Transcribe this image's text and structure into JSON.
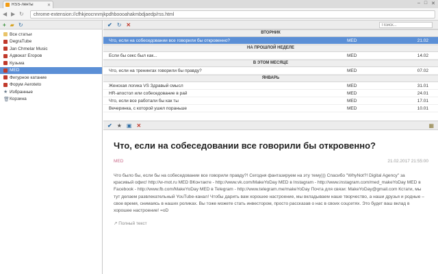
{
  "browser": {
    "tab_title": "RSS-ленты",
    "url": "chrome-extension://cfhkjeocnnmjkpdhboooahakmbdjaedp/rss.html"
  },
  "sidebar": {
    "items": [
      {
        "label": "Все статьи",
        "icon": "folder-icon"
      },
      {
        "label": "DegraTube",
        "icon": "feed-icon"
      },
      {
        "label": "Jan Chmelar Music",
        "icon": "feed-icon"
      },
      {
        "label": "Адвокат Егоров",
        "icon": "feed-icon"
      },
      {
        "label": "Кузьма",
        "icon": "feed-icon"
      },
      {
        "label": "MED",
        "icon": "feed-icon"
      },
      {
        "label": "Фигурное катание",
        "icon": "feed-icon"
      },
      {
        "label": "Форум Aeroteto",
        "icon": "feed-icon"
      },
      {
        "label": "Избранные",
        "icon": "star-icon"
      },
      {
        "label": "Корзина",
        "icon": "trash-icon"
      }
    ]
  },
  "list": {
    "search_placeholder": "Поиск...",
    "groups": [
      {
        "label": "ВТОРНИК",
        "rows": [
          {
            "title": "Что, если на собеседовании все говорили бы откровенно?",
            "feed": "MED",
            "date": "21.02",
            "selected": true
          }
        ]
      },
      {
        "label": "НА ПРОШЛОЙ НЕДЕЛЕ",
        "rows": [
          {
            "title": "Если бы секс был как...",
            "feed": "MED",
            "date": "14.02",
            "selected": false
          }
        ]
      },
      {
        "label": "В ЭТОМ МЕСЯЦЕ",
        "rows": [
          {
            "title": "Что, если на тренингах говорили бы правду?",
            "feed": "MED",
            "date": "07.02",
            "selected": false
          }
        ]
      },
      {
        "label": "ЯНВАРЬ",
        "rows": [
          {
            "title": "Женская логика VS Здравый смысл",
            "feed": "MED",
            "date": "31.01",
            "selected": false
          },
          {
            "title": "HR-апостол или собеседование в рай",
            "feed": "MED",
            "date": "24.01",
            "selected": false
          },
          {
            "title": "Что, если все работали бы как ты",
            "feed": "MED",
            "date": "17.01",
            "selected": false
          },
          {
            "title": "Вечеринка, с которой ушел пораньше",
            "feed": "MED",
            "date": "10.01",
            "selected": false
          }
        ]
      }
    ]
  },
  "article": {
    "title": "Что, если на собеседовании все говорили бы откровенно?",
    "feed": "MED",
    "date": "21.02.2017 21:55:00",
    "body": "Что было бы, если бы на собеседовании все говорили правду?! Сегодня фантазируем на эту тему))) Спасибо \"WhyNot?! Digital Agency\" за красивый офис! http://w-mot.ru MED ВКонтакте - http://www.vk.com/MakeYoDay MED в Instagram - http://www.instagram.com/med_makeYoDay MED в Facebook - http://www.fb.com/MakeYoDay MED в Telegram - http://www.telegram.me/makeYoDay Почта для связи: MakeYoDay@gmail.com Кстати, мы тут делаем развлекательный YouTube-канал! Чтобы дарить вам хорошее настроение, мы вкладываем наше творчество, а наши друзья и родные – свое время, снимаясь в наших роликах. Вы тоже можете стать инвестором, просто рассказав о нас в своих соцсетях. Это будет ваш вклад в хорошее настроение! =oD",
    "full_text_link": "Полный текст"
  }
}
